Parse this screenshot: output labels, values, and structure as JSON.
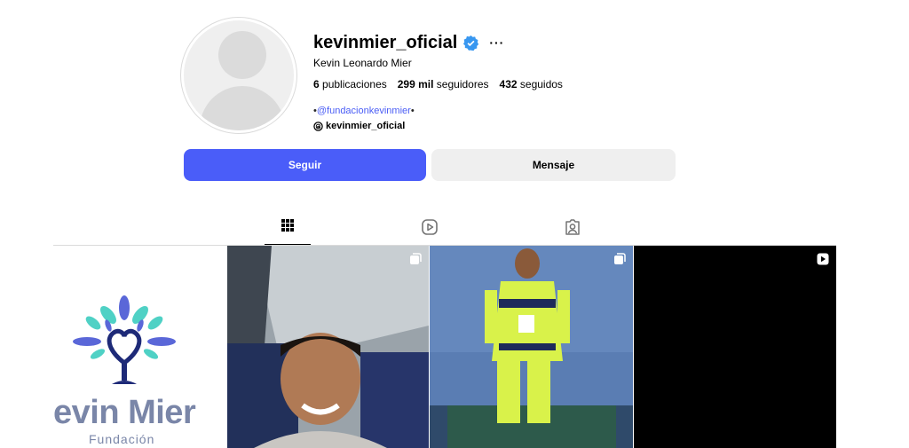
{
  "profile": {
    "username": "kevinmier_oficial",
    "full_name": "Kevin Leonardo Mier",
    "more_label": "···",
    "verified_color": "#3897f0"
  },
  "stats": {
    "posts_count": "6",
    "posts_label": "publicaciones",
    "followers_count": "299 mil",
    "followers_label": "seguidores",
    "following_count": "432",
    "following_label": "seguidos"
  },
  "bio": {
    "prefix": "•",
    "link": "@fundacionkevinmier",
    "suffix": "•",
    "threads_handle": "kevinmier_oficial"
  },
  "actions": {
    "follow_label": "Seguir",
    "message_label": "Mensaje"
  },
  "tabs": [
    {
      "name": "posts",
      "icon": "grid-icon",
      "active": true
    },
    {
      "name": "reels",
      "icon": "reels-icon",
      "active": false
    },
    {
      "name": "tagged",
      "icon": "tagged-icon",
      "active": false
    }
  ],
  "grid": {
    "tile_1": {
      "wordmark": "evin Mier",
      "sub": "Fundación"
    },
    "tile_2": {
      "badge": "carousel-icon"
    },
    "tile_3": {
      "badge": "carousel-icon"
    },
    "tile_4": {
      "badge": "reel-icon"
    }
  },
  "colors": {
    "accent": "#4a5df9",
    "link": "#4a5df5",
    "button_secondary": "#efefef"
  }
}
